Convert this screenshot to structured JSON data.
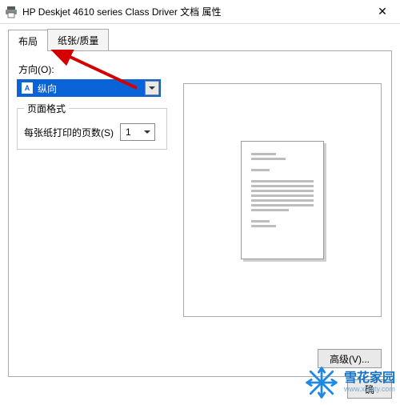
{
  "window": {
    "title": "HP Deskjet 4610 series Class Driver 文档 属性",
    "close_glyph": "✕"
  },
  "tabs": {
    "layout": "布局",
    "paper_quality": "纸张/质量"
  },
  "orientation": {
    "label": "方向(O):",
    "value": "纵向",
    "icon_letter": "A"
  },
  "page_format": {
    "legend": "页面格式",
    "pages_per_sheet_label": "每张纸打印的页数(S)",
    "pages_per_sheet_value": "1"
  },
  "buttons": {
    "advanced": "高级(V)...",
    "ok": "确"
  },
  "watermark": {
    "brand": "雪花家园",
    "url": "www.xhjaty.com"
  }
}
